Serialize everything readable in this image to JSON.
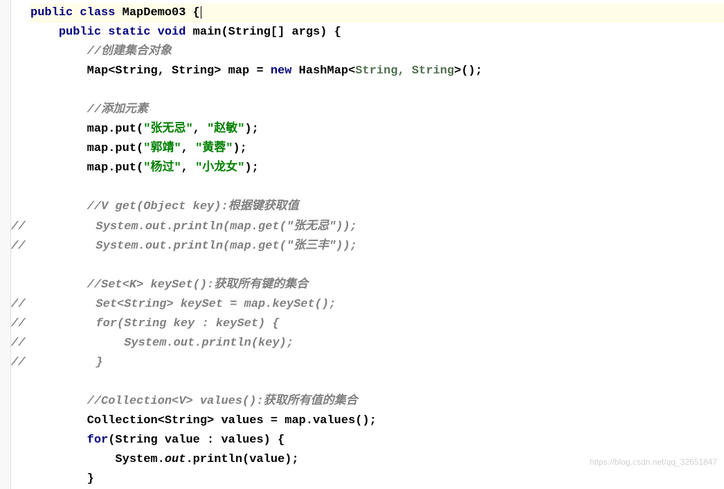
{
  "code": {
    "class_decl": {
      "kw_public": "public",
      "kw_class": "class",
      "class_name": "MapDemo03",
      "brace_open": "{"
    },
    "main_decl": {
      "kw_public": "public",
      "kw_static": "static",
      "kw_void": "void",
      "method_name": "main",
      "params": "(String[] args) {",
      "brace_open": "{"
    },
    "comment_create": "//创建集合对象",
    "map_decl": {
      "prefix": "Map<String, String> map = ",
      "kw_new": "new",
      "suffix1": " HashMap<",
      "type_params": "String, String",
      "suffix2": ">();"
    },
    "comment_add": "//添加元素",
    "put1": {
      "prefix": "map.put(",
      "key": "\"张无忌\"",
      "comma": ", ",
      "value": "\"赵敏\"",
      "suffix": ");"
    },
    "put2": {
      "prefix": "map.put(",
      "key": "\"郭靖\"",
      "comma": ", ",
      "value": "\"黄蓉\"",
      "suffix": ");"
    },
    "put3": {
      "prefix": "map.put(",
      "key": "\"杨过\"",
      "comma": ", ",
      "value": "\"小龙女\"",
      "suffix": ");"
    },
    "comment_get": "//V get(Object key):根据键获取值",
    "commented_get1_prefix": "//",
    "commented_get1_body": "          System.out.println(map.get(\"张无忌\"));",
    "commented_get2_prefix": "//",
    "commented_get2_body": "          System.out.println(map.get(\"张三丰\"));",
    "comment_keyset": "//Set<K> keySet():获取所有键的集合",
    "commented_ks1_prefix": "//",
    "commented_ks1_body": "          Set<String> keySet = map.keySet();",
    "commented_ks2_prefix": "//",
    "commented_ks2_body": "          for(String key : keySet) {",
    "commented_ks3_prefix": "//",
    "commented_ks3_body": "              System.out.println(key);",
    "commented_ks4_prefix": "//",
    "commented_ks4_body": "          }",
    "comment_values": "//Collection<V> values():获取所有值的集合",
    "values_decl": "Collection<String> values = map.values();",
    "for_line": {
      "kw_for": "for",
      "rest": "(String value : values) {"
    },
    "println_line": {
      "prefix": "System.",
      "out": "out",
      "suffix": ".println(value);"
    },
    "close_brace": "}"
  },
  "watermark": "https://blog.csdn.net/qq_32651847"
}
